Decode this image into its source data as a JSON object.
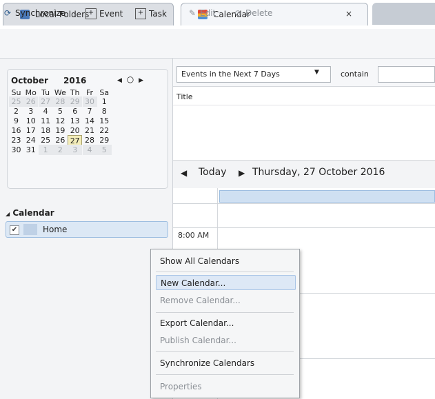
{
  "tabs": [
    {
      "label": "Local Folders"
    },
    {
      "label": "Calendar",
      "close": "×"
    }
  ],
  "toolbar": {
    "synchronize": "Synchronize",
    "event": "Event",
    "task": "Task",
    "edit": "Edit",
    "delete": "Delete"
  },
  "minicalendar": {
    "month": "October",
    "year": "2016",
    "prev": "◀",
    "today_btn": "○",
    "next": "▶",
    "weekdays": [
      "Su",
      "Mo",
      "Tu",
      "We",
      "Th",
      "Fr",
      "Sa"
    ],
    "weeks": [
      [
        "25",
        "26",
        "27",
        "28",
        "29",
        "30",
        "1"
      ],
      [
        "2",
        "3",
        "4",
        "5",
        "6",
        "7",
        "8"
      ],
      [
        "9",
        "10",
        "11",
        "12",
        "13",
        "14",
        "15"
      ],
      [
        "16",
        "17",
        "18",
        "19",
        "20",
        "21",
        "22"
      ],
      [
        "23",
        "24",
        "25",
        "26",
        "27",
        "28",
        "29"
      ],
      [
        "30",
        "31",
        "1",
        "2",
        "3",
        "4",
        "5"
      ]
    ],
    "selected_day": "27"
  },
  "calendars": {
    "heading": "Calendar",
    "items": [
      {
        "label": "Home",
        "checked": "✔"
      }
    ]
  },
  "filter": {
    "selected": "Events in the Next 7 Days",
    "contain_label": "contain",
    "search_value": ""
  },
  "list": {
    "column_title": "Title"
  },
  "daynav": {
    "prev": "◀",
    "today": "Today",
    "next": "▶",
    "date": "Thursday, 27 October 2016"
  },
  "dayview": {
    "time_label": "8:00 AM"
  },
  "context_menu": {
    "items": [
      {
        "label": "Show All Calendars",
        "enabled": true
      },
      {
        "label": "New Calendar...",
        "enabled": true,
        "highlighted": true
      },
      {
        "label": "Remove Calendar...",
        "enabled": false
      },
      {
        "label": "Export Calendar...",
        "enabled": true
      },
      {
        "label": "Publish Calendar...",
        "enabled": false
      },
      {
        "label": "Synchronize Calendars",
        "enabled": true
      },
      {
        "label": "Properties",
        "enabled": false
      }
    ]
  },
  "colors": {
    "accent": "#dde8f6",
    "today_highlight": "#f3edb9"
  }
}
